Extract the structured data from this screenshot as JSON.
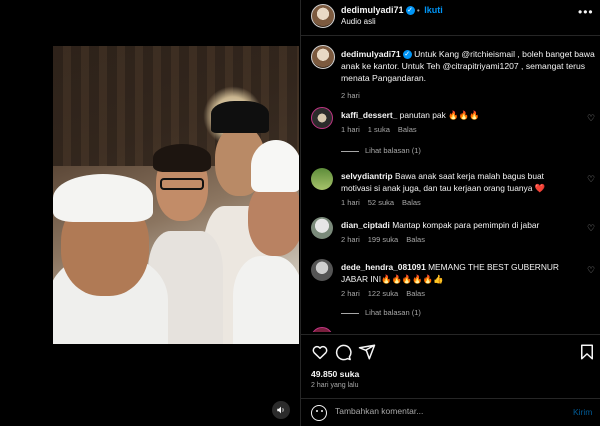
{
  "header": {
    "username": "dedimulyadi71",
    "follow_separator": "•",
    "follow_label": "Ikuti",
    "audio": "Audio asli",
    "more_icon": "more-horizontal-icon"
  },
  "caption": {
    "username": "dedimulyadi71",
    "text": "Untuk Kang @ritchieismail , boleh banget bawa anak ke kantor. Untuk Teh @citrapitriyami1207 , semangat terus menata Pangandaran.",
    "time": "2 hari"
  },
  "comments": [
    {
      "username": "kaffi_dessert_",
      "text": "panutan pak 🔥🔥🔥",
      "time": "1 hari",
      "likes": "1 suka",
      "reply": "Balas",
      "view_replies": "Lihat balasan (1)"
    },
    {
      "username": "selvydiantrip",
      "text": "Bawa anak saat kerja malah bagus buat motivasi si anak juga, dan tau kerjaan orang tuanya ❤️",
      "time": "1 hari",
      "likes": "52 suka",
      "reply": "Balas"
    },
    {
      "username": "dian_ciptadi",
      "text": "Mantap kompak para pemimpin di jabar",
      "time": "2 hari",
      "likes": "199 suka",
      "reply": "Balas"
    },
    {
      "username": "dede_hendra_081091",
      "text": "MEMANG THE BEST GUBERNUR JABAR INI🔥🔥🔥🔥🔥👍",
      "time": "2 hari",
      "likes": "122 suka",
      "reply": "Balas",
      "view_replies": "Lihat balasan (1)"
    }
  ],
  "actions": {
    "likes": "49.850 suka",
    "ago": "2 hari yang lalu",
    "icons": [
      "heart-icon",
      "comment-icon",
      "share-icon",
      "bookmark-icon"
    ]
  },
  "add_comment": {
    "placeholder": "Tambahkan komentar...",
    "post_label": "Kirim"
  },
  "colors": {
    "accent": "#0095f6",
    "background": "#000000",
    "muted": "#a8a8a8",
    "border": "#262626"
  }
}
